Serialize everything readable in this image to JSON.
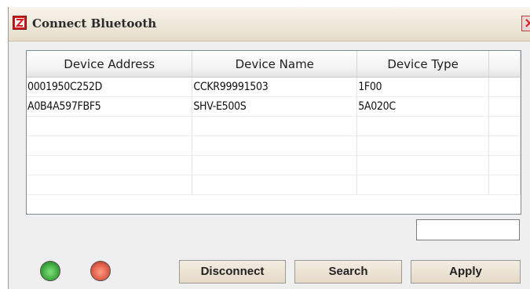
{
  "window": {
    "title": "Connect Bluetooth",
    "close_glyph": "×"
  },
  "table": {
    "columns": [
      "Device Address",
      "Device Name",
      "Device Type",
      ""
    ],
    "rows": [
      [
        "0001950C252D",
        "CCKR99991503",
        "1F00",
        ""
      ],
      [
        "A0B4A597FBF5",
        "SHV-E500S",
        "5A020C",
        ""
      ],
      [
        "",
        "",
        "",
        ""
      ],
      [
        "",
        "",
        "",
        ""
      ],
      [
        "",
        "",
        "",
        ""
      ],
      [
        "",
        "",
        "",
        ""
      ]
    ]
  },
  "input": {
    "value": ""
  },
  "status": {
    "green_led": "green-status-light",
    "red_led": "red-status-light",
    "green_color": "#4cc44c",
    "red_color": "#e2604b"
  },
  "buttons": {
    "disconnect": "Disconnect",
    "search": "Search",
    "apply": "Apply"
  }
}
